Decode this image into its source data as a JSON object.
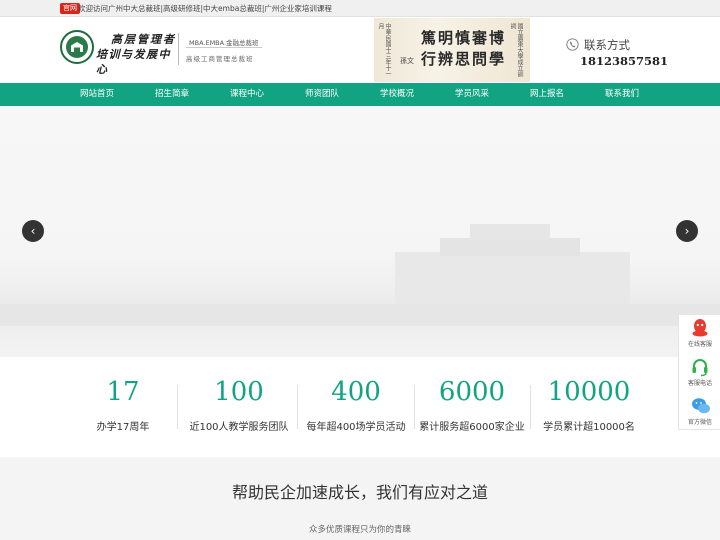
{
  "topbar": {
    "badge": "官网",
    "welcome": "欢迎访问广州中大总裁班|高级研修班|中大emba总裁班|广州企业家培训课程"
  },
  "header": {
    "logo_line1": "高层管理者",
    "logo_line2": "培训与发展中心",
    "logo_sub1": "MBA.EMBA.金融总裁班",
    "logo_sub2": "高级工商管理总裁班",
    "calligraphy_main_1": "篤明慎審博",
    "calligraphy_main_2": "行辨思問學",
    "calligraphy_left": "中華民國十三年十一月",
    "calligraphy_right": "國立廣東大學成立訓詞",
    "calligraphy_seal": "孫文",
    "contact_label": "联系方式",
    "contact_phone": "18123857581",
    "contact_icon": "phone-icon"
  },
  "nav": {
    "items": [
      "网站首页",
      "招生简章",
      "课程中心",
      "师资团队",
      "学校概况",
      "学员风采",
      "网上报名",
      "联系我们"
    ]
  },
  "banner": {
    "prev_icon": "chevron-left-icon",
    "next_icon": "chevron-right-icon",
    "prev_glyph": "‹",
    "next_glyph": "›"
  },
  "side_float": {
    "items": [
      {
        "label": "在线客服",
        "icon": "qq-icon"
      },
      {
        "label": "客服电话",
        "icon": "headset-icon"
      },
      {
        "label": "官方微信",
        "icon": "wechat-icon"
      }
    ]
  },
  "stats": [
    {
      "value": "17",
      "caption": "办学17周年"
    },
    {
      "value": "100",
      "caption": "近100人教学服务团队"
    },
    {
      "value": "400",
      "caption": "每年超400场学员活动"
    },
    {
      "value": "6000",
      "caption": "累计服务超6000家企业"
    },
    {
      "value": "10000",
      "caption": "学员累计超10000名"
    }
  ],
  "section": {
    "heading": "帮助民企加速成长，我们有应对之道",
    "sub": "众多优质课程只为你的青睐"
  },
  "colors": {
    "accent": "#12a482",
    "badge": "#d8261b"
  }
}
